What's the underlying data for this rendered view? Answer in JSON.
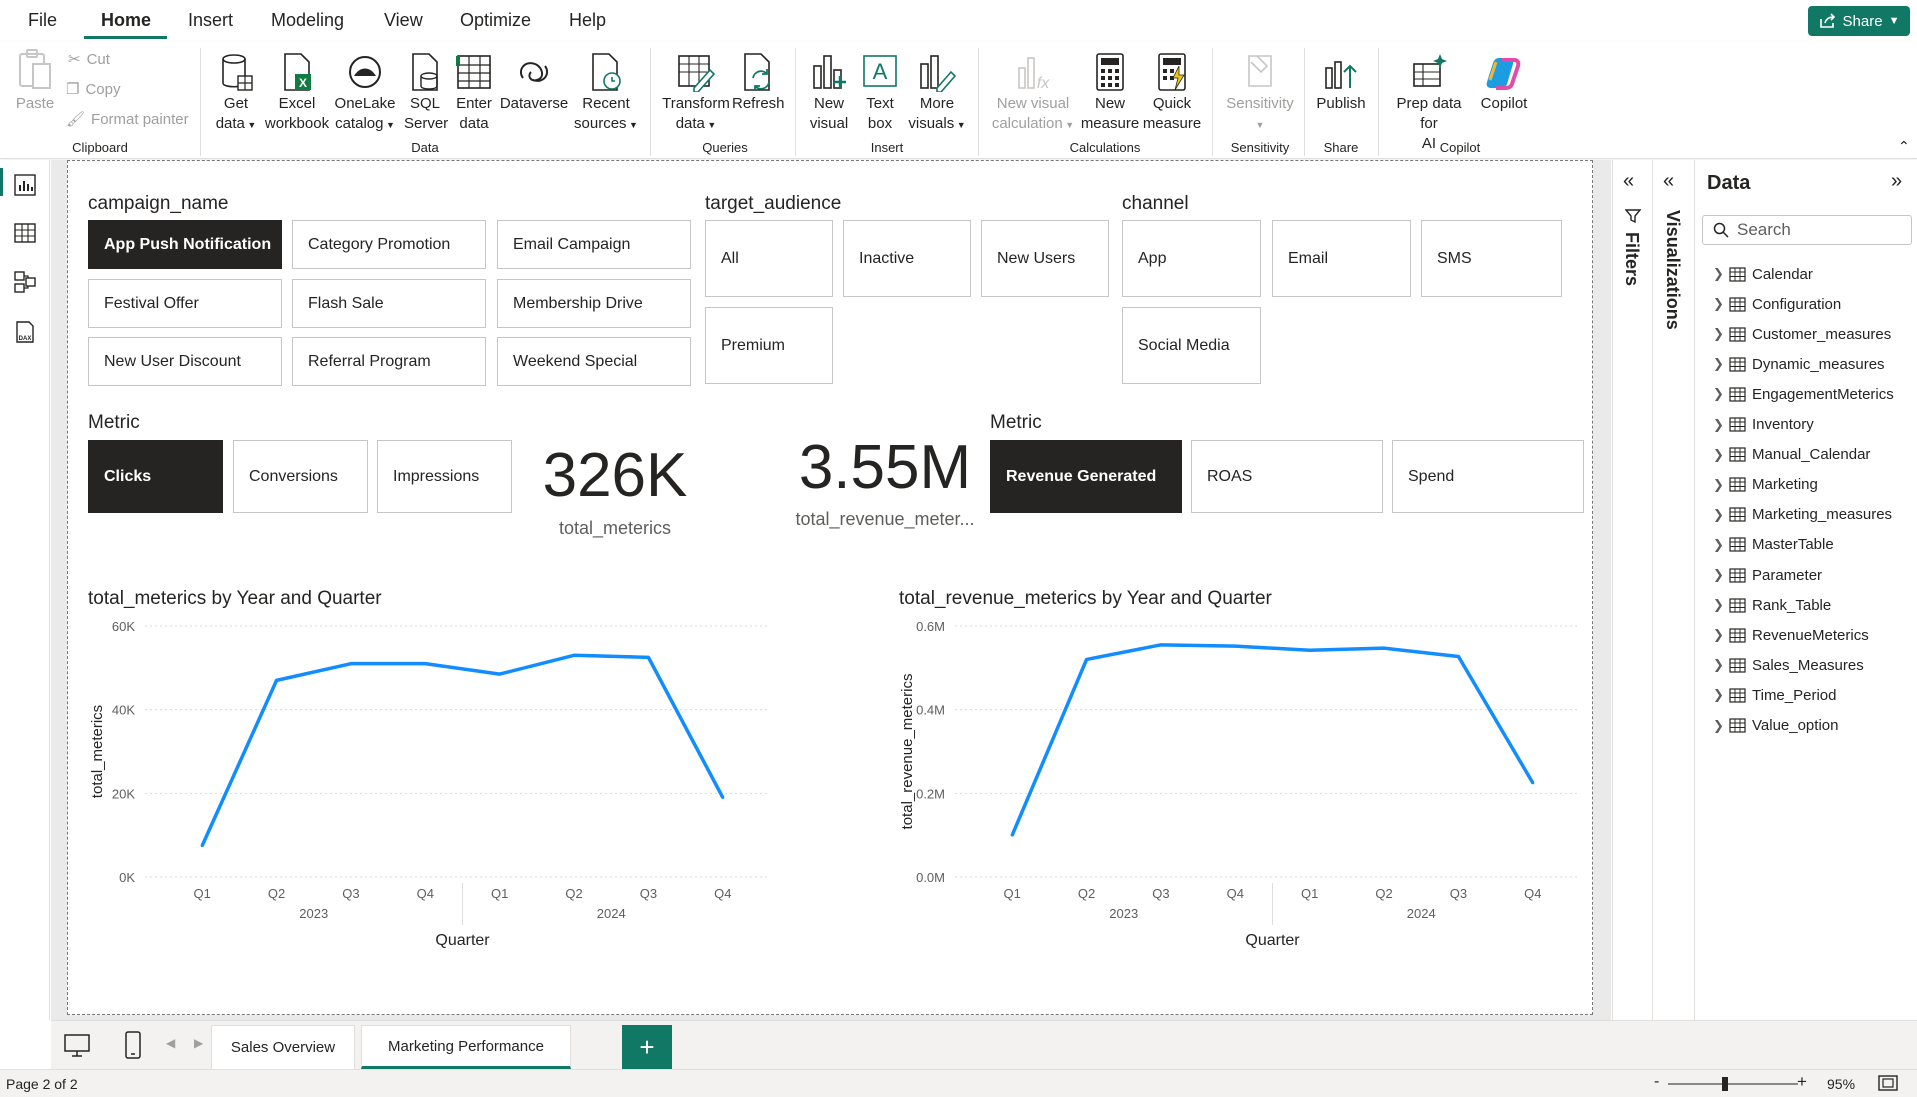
{
  "menu": {
    "file": "File",
    "home": "Home",
    "insert": "Insert",
    "modeling": "Modeling",
    "view": "View",
    "optimize": "Optimize",
    "help": "Help",
    "share": "Share"
  },
  "ribbon": {
    "clipboard": {
      "paste": "Paste",
      "cut": "Cut",
      "copy": "Copy",
      "format_painter": "Format painter",
      "label": "Clipboard"
    },
    "data": {
      "get_data": [
        "Get",
        "data"
      ],
      "excel": [
        "Excel",
        "workbook"
      ],
      "onelake": [
        "OneLake",
        "catalog"
      ],
      "sql": [
        "SQL",
        "Server"
      ],
      "enter": [
        "Enter",
        "data"
      ],
      "dataverse": "Dataverse",
      "recent": [
        "Recent",
        "sources"
      ],
      "label": "Data"
    },
    "queries": {
      "transform": [
        "Transform",
        "data"
      ],
      "refresh": "Refresh",
      "label": "Queries"
    },
    "insert": {
      "new_visual": [
        "New",
        "visual"
      ],
      "text_box": [
        "Text",
        "box"
      ],
      "more_visuals": [
        "More",
        "visuals"
      ],
      "label": "Insert"
    },
    "calculations": {
      "new_visual_calc": [
        "New visual",
        "calculation"
      ],
      "new_measure": [
        "New",
        "measure"
      ],
      "quick_measure": [
        "Quick",
        "measure"
      ],
      "label": "Calculations"
    },
    "sensitivity": {
      "button": "Sensitivity",
      "label": "Sensitivity"
    },
    "share": {
      "publish": "Publish",
      "label": "Share"
    },
    "copilot": {
      "prep": [
        "Prep data for",
        "AI"
      ],
      "copilot": "Copilot",
      "label": "Copilot"
    }
  },
  "slicers": {
    "campaign": {
      "title": "campaign_name",
      "items": [
        "App Push Notification",
        "Category Promotion",
        "Email Campaign",
        "Festival Offer",
        "Flash Sale",
        "Membership Drive",
        "New User Discount",
        "Referral Program",
        "Weekend Special"
      ],
      "selected": "App Push Notification"
    },
    "audience": {
      "title": "target_audience",
      "items": [
        "All",
        "Inactive",
        "New Users",
        "Premium"
      ]
    },
    "channel": {
      "title": "channel",
      "items": [
        "App",
        "Email",
        "SMS",
        "Social Media"
      ]
    },
    "metric1": {
      "title": "Metric",
      "items": [
        "Clicks",
        "Conversions",
        "Impressions"
      ],
      "selected": "Clicks"
    },
    "metric2": {
      "title": "Metric",
      "items": [
        "Revenue Generated",
        "ROAS",
        "Spend"
      ],
      "selected": "Revenue Generated"
    }
  },
  "cards": {
    "total_metrics": {
      "value": "326K",
      "label": "total_meterics"
    },
    "total_revenue": {
      "value": "3.55M",
      "label": "total_revenue_meter..."
    }
  },
  "chart_data": [
    {
      "type": "line",
      "title": "total_meterics by Year and Quarter",
      "xlabel": "Quarter",
      "ylabel": "total_meterics",
      "categories": [
        "Q1",
        "Q2",
        "Q3",
        "Q4",
        "Q1",
        "Q2",
        "Q3",
        "Q4"
      ],
      "groups": [
        {
          "label": "2023",
          "count": 4
        },
        {
          "label": "2024",
          "count": 4
        }
      ],
      "yticks": [
        "0K",
        "20K",
        "40K",
        "60K"
      ],
      "ylim": [
        0,
        60000
      ],
      "values": [
        7500,
        47000,
        51000,
        51000,
        48500,
        53000,
        52500,
        19000
      ],
      "color": "#118dff",
      "grid": true
    },
    {
      "type": "line",
      "title": "total_revenue_meterics by Year and Quarter",
      "xlabel": "Quarter",
      "ylabel": "total_revenue_meterics",
      "categories": [
        "Q1",
        "Q2",
        "Q3",
        "Q4",
        "Q1",
        "Q2",
        "Q3",
        "Q4"
      ],
      "groups": [
        {
          "label": "2023",
          "count": 4
        },
        {
          "label": "2024",
          "count": 4
        }
      ],
      "yticks": [
        "0.0M",
        "0.2M",
        "0.4M",
        "0.6M"
      ],
      "ylim": [
        0,
        600000
      ],
      "values": [
        100000,
        520000,
        555000,
        552000,
        542000,
        547000,
        527000,
        225000
      ],
      "color": "#118dff",
      "grid": true
    }
  ],
  "panes": {
    "filters": "Filters",
    "visualizations": "Visualizations",
    "data_title": "Data",
    "search_placeholder": "Search",
    "tables": [
      "Calendar",
      "Configuration",
      "Customer_measures",
      "Dynamic_measures",
      "EngagementMeterics",
      "Inventory",
      "Manual_Calendar",
      "Marketing",
      "Marketing_measures",
      "MasterTable",
      "Parameter",
      "Rank_Table",
      "RevenueMeterics",
      "Sales_Measures",
      "Time_Period",
      "Value_option"
    ]
  },
  "tabs": [
    "Sales Overview",
    "Marketing Performance"
  ],
  "active_tab": "Marketing Performance",
  "status": {
    "page": "Page 2 of 2",
    "zoom": "95%",
    "zoom_minus": "-",
    "zoom_plus": "+"
  },
  "colors": {
    "accent": "#117865",
    "line": "#118dff",
    "selected_tile": "#252423"
  }
}
